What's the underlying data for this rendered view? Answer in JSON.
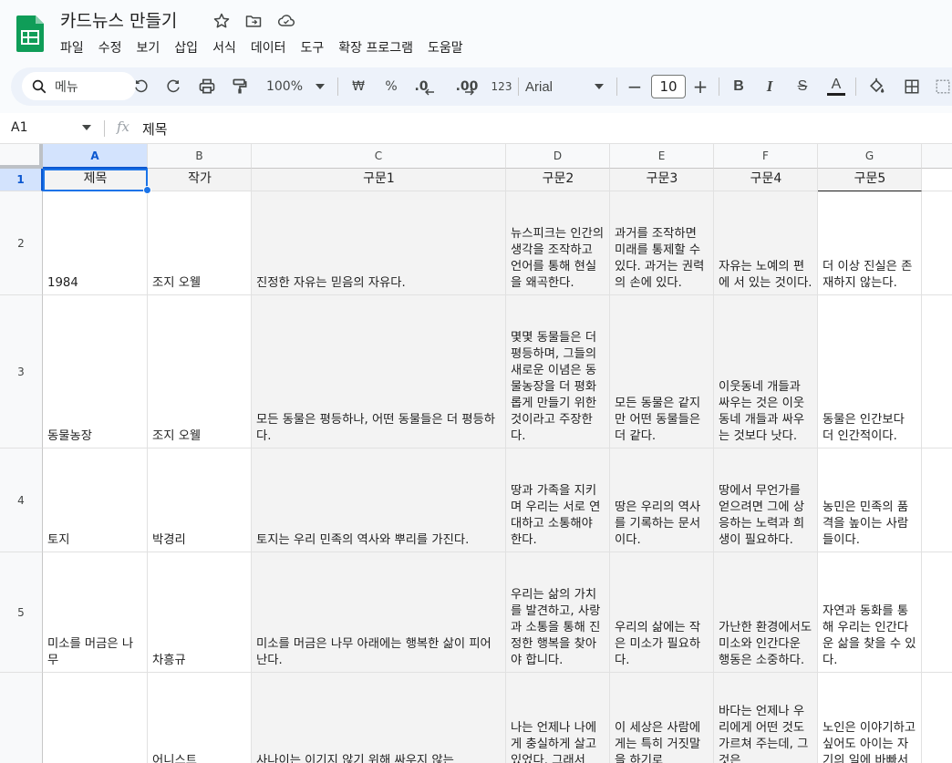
{
  "document": {
    "title": "카드뉴스 만들기",
    "menu": [
      "파일",
      "수정",
      "보기",
      "삽입",
      "서식",
      "데이터",
      "도구",
      "확장 프로그램",
      "도움말"
    ]
  },
  "toolbar": {
    "search_label": "메뉴",
    "zoom": "100%",
    "currency": "₩",
    "percent": "%",
    "dec_decrease": ".0",
    "dec_increase": ".00",
    "number_format": "123",
    "font": "Arial",
    "font_size": "10",
    "minus": "−",
    "plus": "+",
    "bold": "B",
    "italic": "I",
    "strike": "S",
    "text_color": "A"
  },
  "formula_bar": {
    "cell_ref": "A1",
    "fx": "fx",
    "value": "제목"
  },
  "grid": {
    "columns": [
      "A",
      "B",
      "C",
      "D",
      "E",
      "F",
      "G"
    ],
    "rows": [
      {
        "num": "1",
        "cells": [
          "제목",
          "작가",
          "구문1",
          "구문2",
          "구문3",
          "구문4",
          "구문5"
        ]
      },
      {
        "num": "2",
        "cells": [
          "1984",
          "조지 오웰",
          "진정한 자유는 믿음의 자유다.",
          "뉴스피크는 인간의 생각을 조작하고 언어를 통해 현실을 왜곡한다.",
          "과거를 조작하면 미래를 통제할 수 있다. 과거는 권력의 손에 있다.",
          "자유는 노예의 편에 서 있는 것이다.",
          "더 이상 진실은 존재하지 않는다."
        ]
      },
      {
        "num": "3",
        "cells": [
          "동물농장",
          "조지 오웰",
          "모든 동물은 평등하나, 어떤 동물들은 더 평등하다.",
          "몇몇 동물들은 더 평등하며, 그들의 새로운 이념은 동물농장을 더 평화롭게 만들기 위한 것이라고 주장한다.",
          "모든 동물은 같지만 어떤 동물들은 더 같다.",
          "이웃동네 개들과 싸우는 것은 이웃동네 개들과 싸우는 것보다 낫다.",
          "동물은 인간보다 더 인간적이다."
        ]
      },
      {
        "num": "4",
        "cells": [
          "토지",
          "박경리",
          "토지는 우리 민족의 역사와 뿌리를 가진다.",
          "땅과 가족을 지키며 우리는 서로 연대하고 소통해야 한다.",
          "땅은 우리의 역사를 기록하는 문서이다.",
          "땅에서 무언가를 얻으려면 그에 상응하는 노력과 희생이 필요하다.",
          "농민은 민족의 품격을 높이는 사람들이다."
        ]
      },
      {
        "num": "5",
        "cells": [
          "미소를 머금은 나무",
          "차흥규",
          "미소를 머금은 나무 아래에는 행복한 삶이 피어난다.",
          "우리는 삶의 가치를 발견하고, 사랑과 소통을 통해 진정한 행복을 찾아야 합니다.",
          "우리의 삶에는 작은 미소가 필요하다.",
          "가난한 환경에서도 미소와 인간다운 행동은 소중하다.",
          "자연과 동화를 통해 우리는 인간다운 삶을 찾을 수 있다."
        ]
      },
      {
        "num": "",
        "cells": [
          "",
          "어니스트",
          "사나이는 이기지 않기 위해 싸우지 않는",
          "나는 언제나 나에게 충실하게 살고 있었다. 그래서",
          "이 세상은 사람에게는 특히 거짓말을 하기로",
          "바다는 언제나 우리에게 어떤 것도 가르쳐 주는데, 그것은",
          "노인은 이야기하고 싶어도 아이는 자기의 일에 바빠서"
        ]
      }
    ]
  },
  "colors": {
    "accent": "#1a73e8",
    "sheets_green": "#0f9d58",
    "toolbar_bg": "#edf2fa",
    "cell_bg": "#f3f3f3"
  }
}
